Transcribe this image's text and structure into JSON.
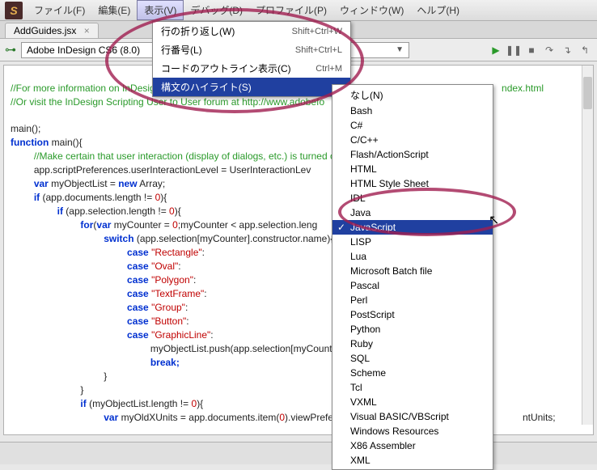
{
  "menubar": {
    "items": [
      "ファイル(F)",
      "編集(E)",
      "表示(V)",
      "デバッグ(D)",
      "プロファイル(P)",
      "ウィンドウ(W)",
      "ヘルプ(H)"
    ],
    "open_index": 2
  },
  "tab": {
    "label": "AddGuides.jsx"
  },
  "target": {
    "label": "Adobe InDesign CS6 (8.0)"
  },
  "view_menu": {
    "items": [
      {
        "label": "行の折り返し(W)",
        "shortcut": "Shift+Ctrl+W"
      },
      {
        "label": "行番号(L)",
        "shortcut": "Shift+Ctrl+L"
      },
      {
        "label": "コードのアウトライン表示(C)",
        "shortcut": "Ctrl+M"
      },
      {
        "label": "構文のハイライト(S)",
        "shortcut": "",
        "submenu": true,
        "highlight": true
      }
    ]
  },
  "syntax_menu": {
    "items": [
      {
        "label": "なし(N)"
      },
      {
        "label": "Bash"
      },
      {
        "label": "C#"
      },
      {
        "label": "C/C++"
      },
      {
        "label": "Flash/ActionScript"
      },
      {
        "label": "HTML"
      },
      {
        "label": "HTML Style Sheet"
      },
      {
        "label": "IDL"
      },
      {
        "label": "Java"
      },
      {
        "label": "JavaScript",
        "selected": true,
        "checked": true
      },
      {
        "label": "LISP"
      },
      {
        "label": "Lua"
      },
      {
        "label": "Microsoft Batch file"
      },
      {
        "label": "Pascal"
      },
      {
        "label": "Perl"
      },
      {
        "label": "PostScript"
      },
      {
        "label": "Python"
      },
      {
        "label": "Ruby"
      },
      {
        "label": "SQL"
      },
      {
        "label": "Scheme"
      },
      {
        "label": "Tcl"
      },
      {
        "label": "VXML"
      },
      {
        "label": "Visual BASIC/VBScript"
      },
      {
        "label": "Windows Resources"
      },
      {
        "label": "X86 Assembler"
      },
      {
        "label": "XML"
      }
    ]
  },
  "code": {
    "l1": "//For more information on InDesign scripting, go to http://www.adobe",
    "l1b": "ndex.html",
    "l2": "//Or visit the InDesign Scripting User to User forum at http://www.adobefo",
    "l3a": "main();",
    "l4a": "function",
    "l4b": " main(){",
    "l5": "//Make certain that user interaction (display of dialogs, etc.) is turned o",
    "l6": "app.scriptPreferences.userInteractionLevel = UserInteractionLev",
    "l7a": "var",
    "l7b": " myObjectList = ",
    "l7c": "new",
    "l7d": " Array;",
    "l8a": "if",
    "l8b": " (app.documents.length != ",
    "l8c": "0",
    "l8d": "){",
    "l9a": "if",
    "l9b": " (app.selection.length != ",
    "l9c": "0",
    "l9d": "){",
    "l10a": "for",
    "l10b": "(",
    "l10c": "var",
    "l10d": " myCounter = ",
    "l10e": "0",
    "l10f": ";myCounter < app.selection.leng",
    "l11a": "switch",
    "l11b": " (app.selection[myCounter].constructor.name){",
    "l12a": "case",
    "l12b": " \"Rectangle\"",
    "l12c": ":",
    "l13a": "case",
    "l13b": " \"Oval\"",
    "l13c": ":",
    "l14a": "case",
    "l14b": " \"Polygon\"",
    "l14c": ":",
    "l15a": "case",
    "l15b": " \"TextFrame\"",
    "l15c": ":",
    "l16a": "case",
    "l16b": " \"Group\"",
    "l16c": ":",
    "l17a": "case",
    "l17b": " \"Button\"",
    "l17c": ":",
    "l18a": "case",
    "l18b": " \"GraphicLine\"",
    "l18c": ":",
    "l19": "myObjectList.push(app.selection[myCounter]);",
    "l20": "break;",
    "l21": "}",
    "l22": "}",
    "l23a": "if",
    "l23b": " (myObjectList.length != ",
    "l23c": "0",
    "l23d": "){",
    "l24a": "var",
    "l24b": " myOldXUnits = app.documents.item(",
    "l24c": "0",
    "l24d": ").viewPrefere",
    "l24e": "ntUnits;"
  }
}
